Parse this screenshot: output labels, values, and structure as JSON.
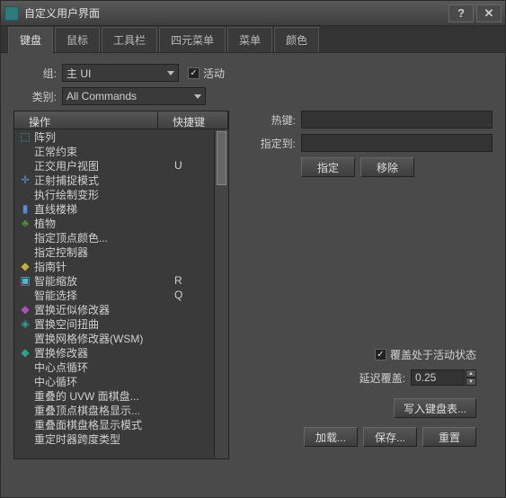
{
  "window": {
    "title": "自定义用户界面"
  },
  "tabs": [
    "键盘",
    "鼠标",
    "工具栏",
    "四元菜单",
    "菜单",
    "颜色"
  ],
  "group": {
    "label": "组:",
    "value": "主 UI",
    "active_label": "活动",
    "active": true
  },
  "category": {
    "label": "类别:",
    "value": "All Commands"
  },
  "list": {
    "col1": "操作",
    "col2": "快捷键",
    "items": [
      {
        "icon": "arr",
        "label": "阵列",
        "key": ""
      },
      {
        "icon": "",
        "label": "正常约束",
        "key": ""
      },
      {
        "icon": "",
        "label": "正交用户视图",
        "key": "U"
      },
      {
        "icon": "cross",
        "label": "正射捕捉模式",
        "key": ""
      },
      {
        "icon": "",
        "label": "执行绘制变形",
        "key": ""
      },
      {
        "icon": "bluebox",
        "label": "直线楼梯",
        "key": ""
      },
      {
        "icon": "greentree",
        "label": "植物",
        "key": ""
      },
      {
        "icon": "",
        "label": "指定顶点颜色...",
        "key": ""
      },
      {
        "icon": "",
        "label": "指定控制器",
        "key": ""
      },
      {
        "icon": "yel",
        "label": "指南针",
        "key": ""
      },
      {
        "icon": "cyanbox",
        "label": "智能缩放",
        "key": "R"
      },
      {
        "icon": "",
        "label": "智能选择",
        "key": "Q"
      },
      {
        "icon": "mag",
        "label": "置换近似修改器",
        "key": ""
      },
      {
        "icon": "teal",
        "label": "置换空间扭曲",
        "key": ""
      },
      {
        "icon": "",
        "label": "置换网格修改器(WSM)",
        "key": ""
      },
      {
        "icon": "teal2",
        "label": "置换修改器",
        "key": ""
      },
      {
        "icon": "",
        "label": "中心点循环",
        "key": ""
      },
      {
        "icon": "",
        "label": "中心循环",
        "key": ""
      },
      {
        "icon": "",
        "label": "重叠的 UVW 面棋盘...",
        "key": ""
      },
      {
        "icon": "",
        "label": "重叠顶点棋盘格显示...",
        "key": ""
      },
      {
        "icon": "",
        "label": "重叠面棋盘格显示模式",
        "key": ""
      },
      {
        "icon": "",
        "label": "重定时器跨度类型",
        "key": ""
      }
    ]
  },
  "right": {
    "hotkey_label": "热键:",
    "hotkey_value": "",
    "assigned_label": "指定到:",
    "assigned_value": "",
    "assign_btn": "指定",
    "remove_btn": "移除",
    "override_label": "覆盖处于活动状态",
    "override": true,
    "delay_label": "延迟覆盖:",
    "delay_value": "0.25",
    "write_btn": "写入键盘表...",
    "load_btn": "加载...",
    "save_btn": "保存...",
    "reset_btn": "重置"
  }
}
